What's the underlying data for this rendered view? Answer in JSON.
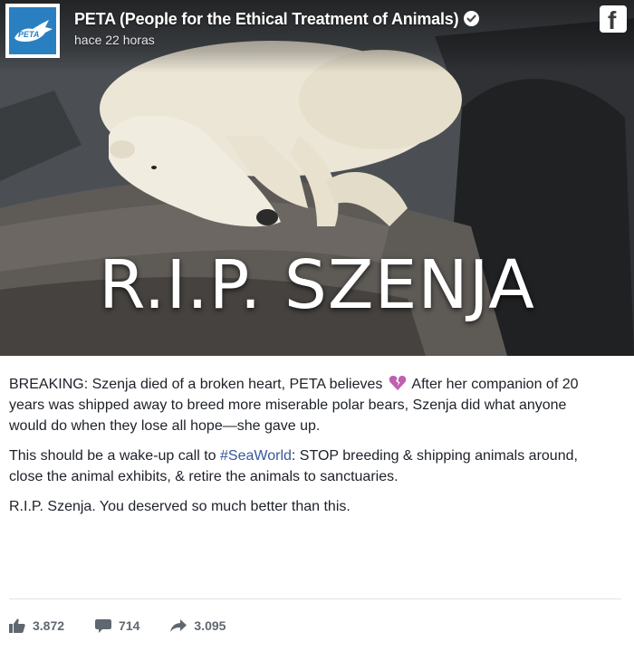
{
  "post": {
    "page_name": "PETA (People for the Ethical Treatment of Animals)",
    "timestamp": "hace 22 horas",
    "avatar_text": "PETA",
    "image_headline": "R.I.P. SZENJA",
    "paragraph1_part1": "BREAKING: Szenja died of a broken heart, PETA believes",
    "paragraph1_part2": "After her companion of 20 years was shipped away to breed more miserable polar bears, Szenja did what anyone would do when they lose all hope—she gave up.",
    "paragraph2_part1": "This should be a wake-up call to",
    "hashtag": "#SeaWorld",
    "paragraph2_part2": ": STOP breeding & shipping animals around, close the animal exhibits, & retire the animals to sanctuaries.",
    "paragraph3": "R.I.P. Szenja. You deserved so much better than this."
  },
  "stats": {
    "likes": "3.872",
    "comments": "714",
    "shares": "3.095"
  },
  "icons": {
    "verified": "verified-check-icon",
    "facebook": "facebook-logo-icon",
    "broken_heart": "broken-heart-icon",
    "like": "thumbs-up-icon",
    "comment": "comment-bubble-icon",
    "share": "share-arrow-icon"
  },
  "colors": {
    "text": "#1d2129",
    "link": "#365899",
    "stats": "#606770",
    "avatar_bg": "#2a7fc1",
    "broken_heart": "#c060b0"
  }
}
